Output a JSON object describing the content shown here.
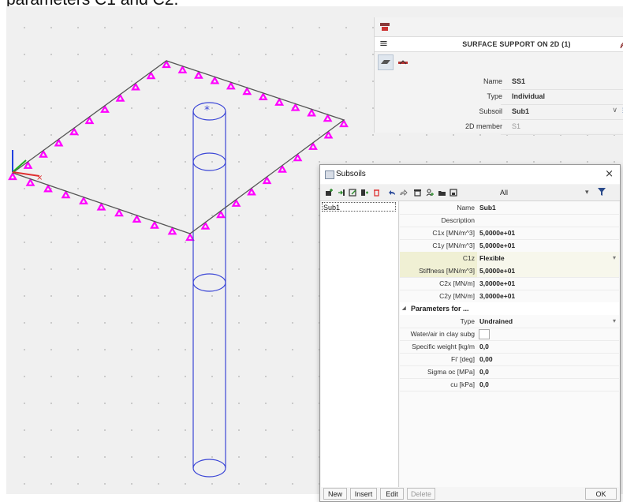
{
  "caption": "parameters C1 and C2.",
  "panel": {
    "title": "SURFACE SUPPORT ON 2D (1)",
    "properties": [
      {
        "label": "Name",
        "value": "SS1",
        "dim": false,
        "dropdown": false
      },
      {
        "label": "Type",
        "value": "Individual",
        "dim": false,
        "dropdown": true
      },
      {
        "label": "Subsoil",
        "value": "Sub1",
        "dim": false,
        "dropdown": true,
        "edit": true
      },
      {
        "label": "2D member",
        "value": "S1",
        "dim": true,
        "dropdown": false
      }
    ]
  },
  "dialog": {
    "title": "Subsoils",
    "close": "×",
    "filter": {
      "value": "All",
      "dropdown": "▾"
    },
    "list": [
      "Sub1"
    ],
    "rows": [
      {
        "label": "Name",
        "value": "Sub1"
      },
      {
        "label": "Description",
        "value": ""
      },
      {
        "label": "C1x [MN/m^3]",
        "value": "5,0000e+01"
      },
      {
        "label": "C1y [MN/m^3]",
        "value": "5,0000e+01"
      },
      {
        "label": "C1z",
        "value": "Flexible",
        "dropdown": true,
        "highlight": true
      },
      {
        "label": "Stiffness [MN/m^3]",
        "value": "5,0000e+01",
        "highlight": true
      },
      {
        "label": "C2x [MN/m]",
        "value": "3,0000e+01"
      },
      {
        "label": "C2y [MN/m]",
        "value": "3,0000e+01"
      }
    ],
    "group_title": "Parameters for ...",
    "group_rows": [
      {
        "label": "Type",
        "value": "Undrained",
        "dropdown": true
      },
      {
        "label": "Water/air in clay subg",
        "value": "",
        "checkbox": true
      },
      {
        "label": "Specific weight [kg/m",
        "value": "0,0"
      },
      {
        "label": "Fi' [deg]",
        "value": "0,00"
      },
      {
        "label": "Sigma oc [MPa]",
        "value": "0,0"
      },
      {
        "label": "cu [kPa]",
        "value": "0,0"
      }
    ],
    "buttons": {
      "new": "New",
      "insert": "Insert",
      "edit": "Edit",
      "delete": "Delete",
      "ok": "OK"
    }
  },
  "colors": {
    "support": "#ff00ff",
    "pile": "#3b46d6",
    "slab_edge": "#555555",
    "axis_x": "#e03030",
    "axis_y": "#20b020",
    "axis_z": "#2040e0"
  }
}
